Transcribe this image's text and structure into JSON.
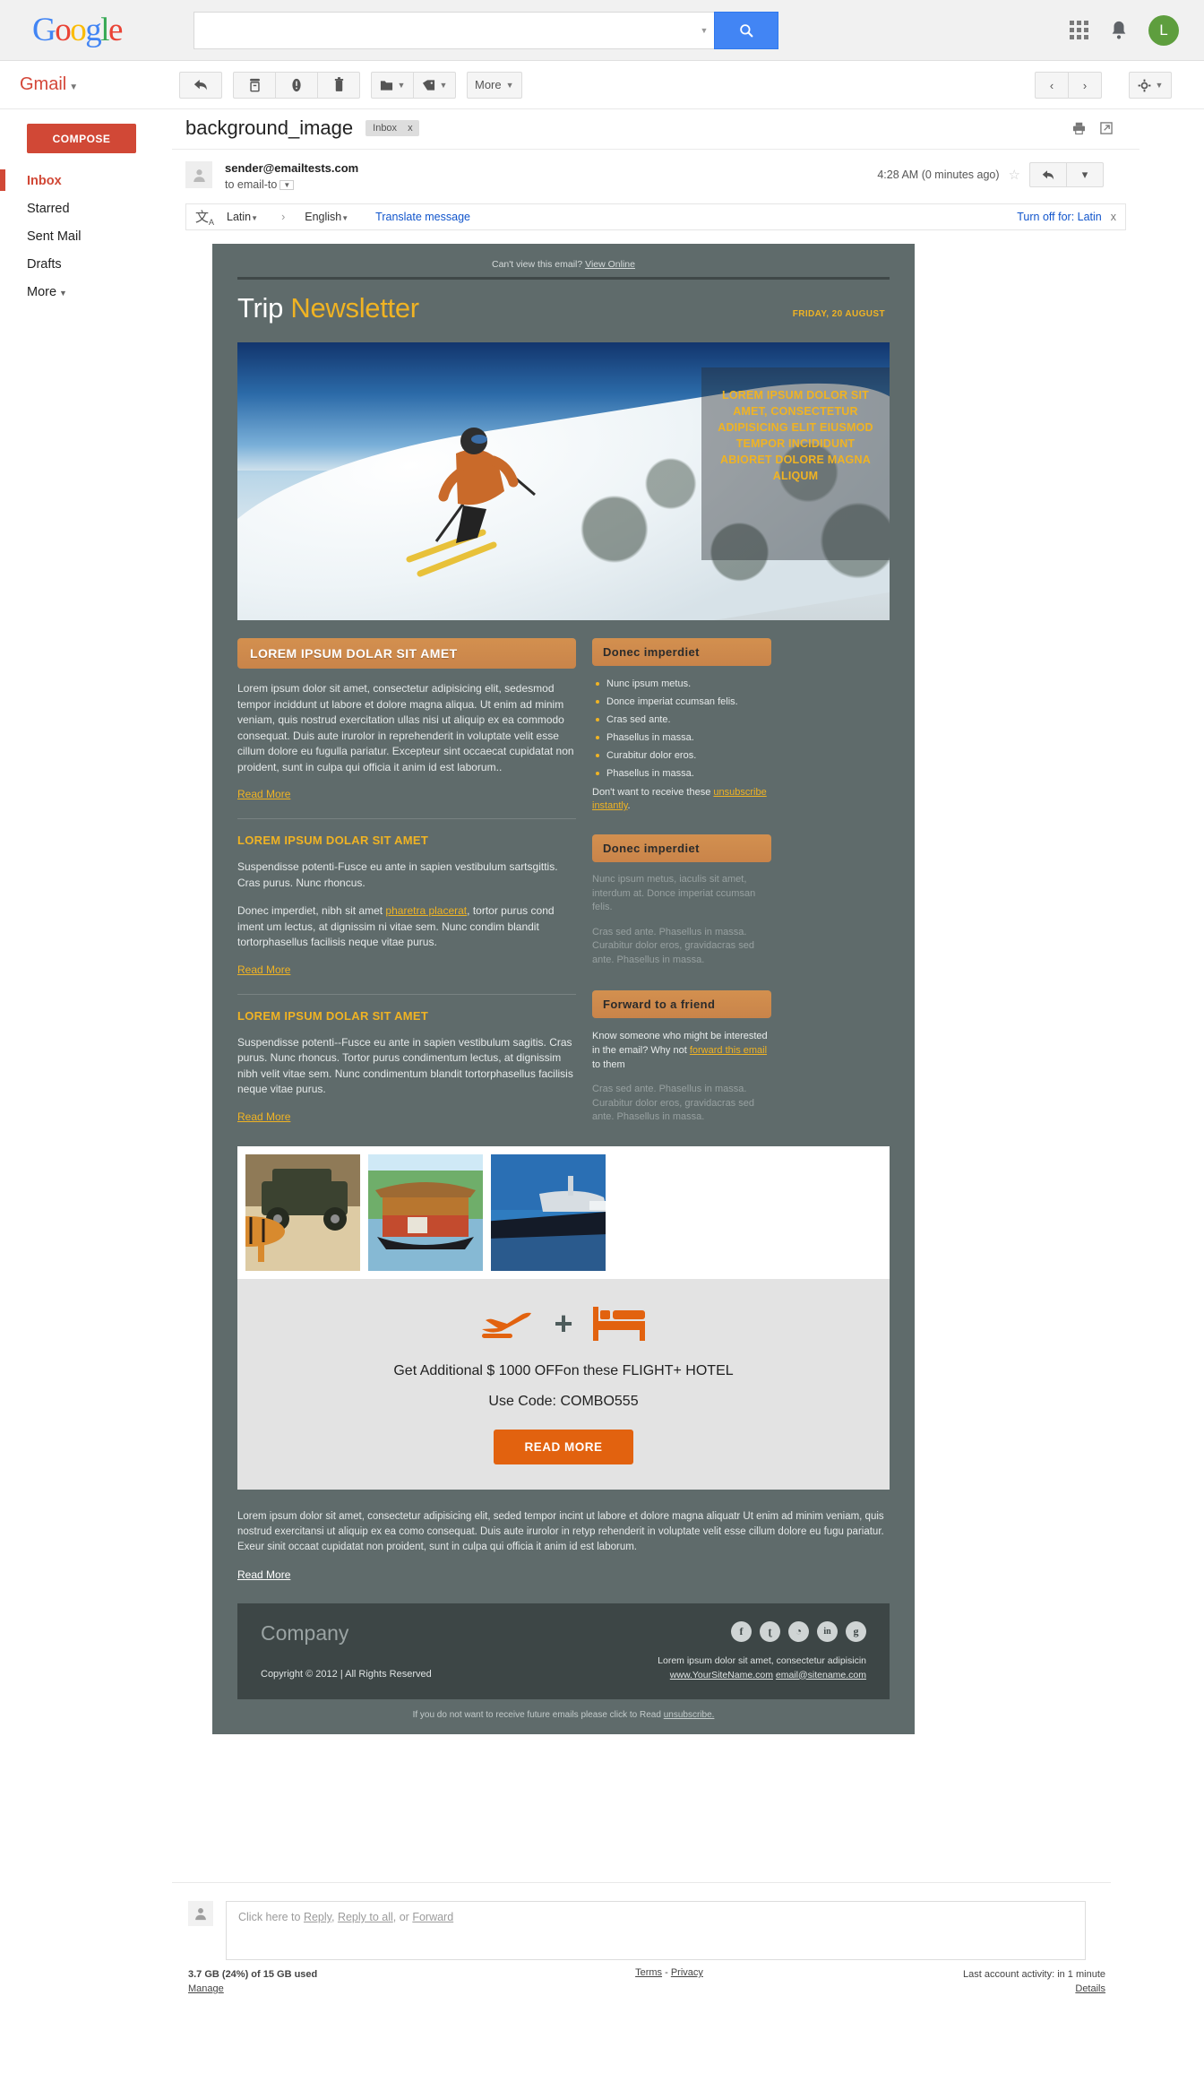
{
  "topbar": {
    "logo": "Google",
    "search_placeholder": "",
    "search_value": "",
    "search_icon": "search-icon",
    "apps_icon": "apps-grid-icon",
    "notifications_icon": "bell-icon",
    "avatar_initial": "L"
  },
  "toolbar": {
    "gmail_label": "Gmail",
    "caret": "▾",
    "back_icon": "back-arrow-icon",
    "archive_icon": "archive-icon",
    "spam_icon": "report-spam-icon",
    "delete_icon": "trash-icon",
    "move_icon": "move-to-folder-icon",
    "label_icon": "labels-icon",
    "more_label": "More",
    "prev_icon": "‹",
    "next_icon": "›",
    "settings_icon": "gear-icon"
  },
  "sidebar": {
    "compose_label": "COMPOSE",
    "items": [
      {
        "label": "Inbox",
        "active": true
      },
      {
        "label": "Starred",
        "active": false
      },
      {
        "label": "Sent Mail",
        "active": false
      },
      {
        "label": "Drafts",
        "active": false
      },
      {
        "label": "More",
        "active": false,
        "caret": "▾"
      }
    ]
  },
  "email": {
    "subject": "background_image",
    "label_chip": "Inbox",
    "label_chip_close": "x",
    "print_icon": "print-icon",
    "popout_icon": "open-in-new-window-icon",
    "sender": "sender@emailtests.com",
    "to": "to email-to",
    "timestamp": "4:28 AM (0 minutes ago)",
    "star_icon": "☆",
    "reply_icon": "reply-icon",
    "more_icon": "▾"
  },
  "translate": {
    "icon": "translate-icon",
    "source_lang": "Latin",
    "arrow": "›",
    "target_lang": "English",
    "translate_link": "Translate message",
    "turn_off": "Turn off for: Latin",
    "close": "x"
  },
  "newsletter": {
    "preheader_text": "Can't view this email?",
    "preheader_link": "View Online",
    "title_1": "Trip",
    "title_2": "Newsletter",
    "date": "FRIDAY, 20 AUGUST",
    "hero_overlay": "LOREM IPSUM DOLOR SIT AMET, CONSECTETUR ADIPISICING ELIT EIUSMOD TEMPOR INCIDIDUNT ABIORET DOLORE MAGNA ALIQUM",
    "articles": [
      {
        "heading": "LOREM IPSUM DOLAR SIT AMET",
        "heading_style": "bar",
        "body": "Lorem ipsum dolor sit amet, consectetur adipisicing elit, sedesmod tempor inciddunt ut labore et dolore magna aliqua. Ut enim ad minim veniam, quis nostrud exercitation ullas nisi ut aliquip ex ea commodo consequat. Duis aute irurolor in reprehenderit in voluptate velit esse cillum dolore eu fugulla pariatur. Excepteur sint occaecat cupidatat non proident, sunt in culpa qui officia it anim id est laborum..",
        "read_more": "Read More"
      },
      {
        "heading": "LOREM IPSUM DOLAR SIT AMET",
        "heading_style": "yellow",
        "body_p1": "Suspendisse potenti-Fusce eu ante in sapien vestibulum sartsgittis. Cras purus. Nunc rhoncus.",
        "body_p2_a": "Donec imperdiet, nibh sit amet ",
        "body_p2_link": "pharetra placerat",
        "body_p2_b": ", tortor purus cond iment um lectus, at dignissim ni vitae sem. Nunc condim blandit tortorphasellus facilisis neque vitae purus.",
        "read_more": "Read More"
      },
      {
        "heading": "LOREM IPSUM DOLAR SIT AMET",
        "heading_style": "yellow",
        "body": "Suspendisse potenti--Fusce eu ante in sapien vestibulum sagitis. Cras purus. Nunc rhoncus. Tortor purus condimentum lectus, at dignissim nibh velit vitae sem. Nunc condimentum blandit tortorphasellus facilisis neque vitae purus.",
        "read_more": "Read More"
      }
    ],
    "sidebar_blocks": [
      {
        "heading": "Donec imperdiet",
        "list": [
          "Nunc ipsum metus.",
          "Donce imperiat ccumsan felis.",
          "Cras sed ante.",
          "Phasellus in massa.",
          "Curabitur dolor eros.",
          "Phasellus in massa."
        ],
        "note_text": "Don't want to receive these",
        "note_link": "unsubscribe instantly",
        "note_tail": "."
      },
      {
        "heading": "Donec imperdiet",
        "faded_p1": "Nunc ipsum metus, iaculis sit amet, interdum at. Donce imperiat ccumsan felis.",
        "faded_p2": "Cras sed ante. Phasellus in massa. Curabitur dolor eros, gravidacras sed ante. Phasellus in massa."
      },
      {
        "heading": "Forward to a friend",
        "text_a": "Know someone who might be interested in the email? Why not ",
        "text_link": "forward this email",
        "text_b": " to them",
        "faded": "Cras sed ante. Phasellus in massa. Curabitur dolor eros, gravidacras sed ante. Phasellus in massa."
      }
    ],
    "gallery": [
      {
        "name": "tiger-safari-jeep-photo"
      },
      {
        "name": "kerala-houseboat-photo"
      },
      {
        "name": "luxury-yacht-photo"
      }
    ],
    "promo": {
      "flight_icon": "airplane-icon",
      "plus": "+",
      "hotel_icon": "bed-icon",
      "line1": "Get Additional $ 1000 OFFon these FLIGHT+ HOTEL",
      "line2": "Use Code: COMBO555",
      "button": "READ MORE"
    },
    "footer_article": {
      "body": "Lorem ipsum dolor sit amet, consectetur adipisicing elit, seded tempor incint ut labore et dolore magna aliquatr Ut enim ad minim veniam, quis nostrud exercitansi ut aliquip ex ea como consequat. Duis aute irurolor in retyp rehenderit in voluptate velit esse cillum dolore eu fugu pariatur. Exeur sinit occaat cupidatat non proident, sunt in culpa qui officia it anim id est laborum.",
      "read_more": "Read More"
    },
    "company": {
      "name": "Company",
      "copyright": "Copyright © 2012  | All Rights Reserved",
      "tagline": "Lorem ipsum dolor sit amet, consectetur adipisicin",
      "website": "www.YourSiteName.com",
      "email": "email@sitename.com",
      "social": [
        {
          "name": "facebook-icon",
          "glyph": "f"
        },
        {
          "name": "twitter-icon",
          "glyph": "ʈ"
        },
        {
          "name": "rss-icon",
          "glyph": "◔"
        },
        {
          "name": "linkedin-icon",
          "glyph": "in"
        },
        {
          "name": "google-icon",
          "glyph": "g"
        }
      ]
    },
    "unsubscribe_text": "If you do not want to receive future emails please click to Read",
    "unsubscribe_link": "unsubscribe."
  },
  "reply": {
    "avatar_icon": "person-icon",
    "prefix": "Click here to ",
    "reply_label": "Reply",
    "sep1": ", ",
    "reply_all_label": "Reply to all",
    "sep2": ", or ",
    "forward_label": "Forward"
  },
  "status": {
    "storage": "3.7 GB (24%) of 15 GB used",
    "manage": "Manage",
    "terms": "Terms",
    "dash": " - ",
    "privacy": "Privacy",
    "activity": "Last account activity: in 1 minute",
    "details": "Details"
  },
  "colors": {
    "brand_red": "#d14836",
    "accent_blue": "#4285f4",
    "newsletter_bg": "#5f6b6b",
    "newsletter_accent": "#f0b323",
    "bar_orange": "#c9844a",
    "promo_orange": "#e2620f",
    "footer_dark": "#3d4646"
  }
}
